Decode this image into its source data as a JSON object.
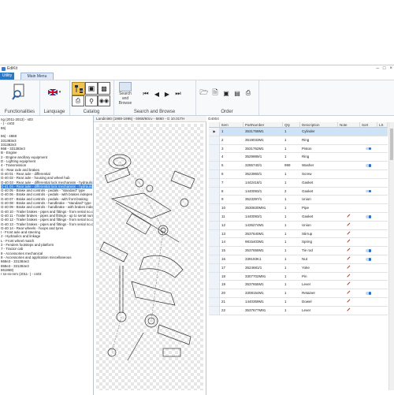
{
  "window": {
    "title": "EdiKit"
  },
  "tabs": [
    {
      "label": "Utility"
    },
    {
      "label": "Main Menu"
    }
  ],
  "ribbon": {
    "groups": [
      {
        "label": "Functionalities"
      },
      {
        "label": "Lanquage"
      },
      {
        "label": "Catalog"
      },
      {
        "label": "Search and Browse"
      },
      {
        "label": "Order"
      }
    ],
    "search_button": "Search and Browse"
  },
  "tree": {
    "items": [
      "ng (2011-2013) - s03",
      "- ) - cs02",
      "86)",
      "",
      "86) - 4868",
      "331383e3",
      "331382e3",
      "868 - 331383e3",
      "B - Engine",
      "2 - Engine ancillary equipment",
      "D - Lighting equipment",
      "4 - Transmission",
      "G - Rear axle and brakes",
      "G-40 01 - Rear axle - differential",
      "G-40 02 - Rear axle - housing and wheel hub",
      "G-40 03 - Rear axle - differential lock mechanism - hydraulic",
      "G-41 04 - Rear axle - differential lock mechanism - hydraulic",
      "G-40 05 - Brake and controls - pedals - \"standard\" type",
      "G-40 06 - Brake and controls - pedals - with brakes indepen",
      "G-40 07 - Brake and controls - pedals - with front braking",
      "G-40 08 - Brake and controls - handbrake - \"standard\" type",
      "G-40 09 - Brake and controls - handbrake - with brakes independent",
      "G-40 10 - Trailer brakes - pipes and fittings - from serial no.c31185 - extra",
      "G-40 11 - Trailer brakes - pipes and fittings - up to serial num",
      "G-40 12 - Trailer brakes - pipes and fittings - from serial no.c",
      "G-40 13 - Trailer brakes - pipes and fittings - from serial no.c",
      "G-40 14 - Rear wheels - hoops and tyres",
      "I - Front axle and steering",
      "J - Hydraulics and linkage",
      "L - Front wheel match",
      "2 - Fenders footsteps and platform",
      "7 - Tractor cab",
      "8 - Accessories mechanical",
      "8 - Accessories and application miscellaneous",
      "868e3 - 331384e3",
      "868e3 - 331384e3",
      "861868)",
      "r ss-ss-rem (2011- ) - cs03"
    ],
    "selected_index": 16
  },
  "drawing": {
    "header": "Landini60 (1988-1995) - 6068/60cv - 6860 -    G 10.01TH"
  },
  "parts": {
    "caption": "G4004",
    "columns": [
      "Item",
      "PartNumber",
      "Qty",
      "Description",
      "Note",
      "Sort",
      "LS"
    ],
    "rows": [
      {
        "item": "1",
        "part": "3531758M1",
        "qty": "1",
        "desc": "Cylinder",
        "pencil": false,
        "toggle": false
      },
      {
        "item": "2",
        "part": "3519033M1",
        "qty": "1",
        "desc": "Ring",
        "pencil": false,
        "toggle": false
      },
      {
        "item": "3",
        "part": "3531762M1",
        "qty": "1",
        "desc": "Piston",
        "pencil": false,
        "toggle": true
      },
      {
        "item": "4",
        "part": "3529989/1",
        "qty": "1",
        "desc": "Ring",
        "pencil": false,
        "toggle": false
      },
      {
        "item": "5",
        "part": "3285740/1",
        "qty": "999",
        "desc": "Washer",
        "pencil": false,
        "toggle": true
      },
      {
        "item": "6",
        "part": "3523960/1",
        "qty": "1",
        "desc": "Screw",
        "pencil": false,
        "toggle": false
      },
      {
        "item": "7",
        "part": "1442418/1",
        "qty": "1",
        "desc": "Gasket",
        "pencil": false,
        "toggle": false
      },
      {
        "item": "8",
        "part": "1440093/1",
        "qty": "2",
        "desc": "Gasket",
        "pencil": false,
        "toggle": true
      },
      {
        "item": "9",
        "part": "3523397/1",
        "qty": "1",
        "desc": "Union",
        "pencil": false,
        "toggle": false
      },
      {
        "item": "10",
        "part": "3530830M91",
        "qty": "1",
        "desc": "Pipe",
        "pencil": false,
        "toggle": false
      },
      {
        "item": "11",
        "part": "1440093/1",
        "qty": "1",
        "desc": "Gasket",
        "pencil": true,
        "toggle": true
      },
      {
        "item": "12",
        "part": "1435274M1",
        "qty": "1",
        "desc": "Union",
        "pencil": true,
        "toggle": false
      },
      {
        "item": "13",
        "part": "3537640M1",
        "qty": "1",
        "desc": "Stirrup",
        "pencil": true,
        "toggle": false
      },
      {
        "item": "14",
        "part": "9815403M1",
        "qty": "1",
        "desc": "Spring",
        "pencil": true,
        "toggle": false
      },
      {
        "item": "15",
        "part": "3537658M1",
        "qty": "1",
        "desc": "Tie rod",
        "pencil": true,
        "toggle": true
      },
      {
        "item": "16",
        "part": "339193K1",
        "qty": "1",
        "desc": "Nut",
        "pencil": true,
        "toggle": true
      },
      {
        "item": "17",
        "part": "3524681/1",
        "qty": "1",
        "desc": "Yoke",
        "pencil": true,
        "toggle": false
      },
      {
        "item": "18",
        "part": "3307702M91",
        "qty": "1",
        "desc": "Pin",
        "pencil": true,
        "toggle": false
      },
      {
        "item": "19",
        "part": "3537655M1",
        "qty": "1",
        "desc": "Lever",
        "pencil": true,
        "toggle": false
      },
      {
        "item": "20",
        "part": "3308154M1",
        "qty": "1",
        "desc": "Retainer",
        "pencil": true,
        "toggle": true
      },
      {
        "item": "21",
        "part": "1440359M1",
        "qty": "1",
        "desc": "Dowel",
        "pencil": true,
        "toggle": false
      },
      {
        "item": "22",
        "part": "3537677M91",
        "qty": "1",
        "desc": "Lever",
        "pencil": true,
        "toggle": false
      }
    ]
  },
  "colors": {
    "accent": "#2b78c4",
    "selection": "#3a7fd5",
    "pencil": "#c0392b"
  }
}
